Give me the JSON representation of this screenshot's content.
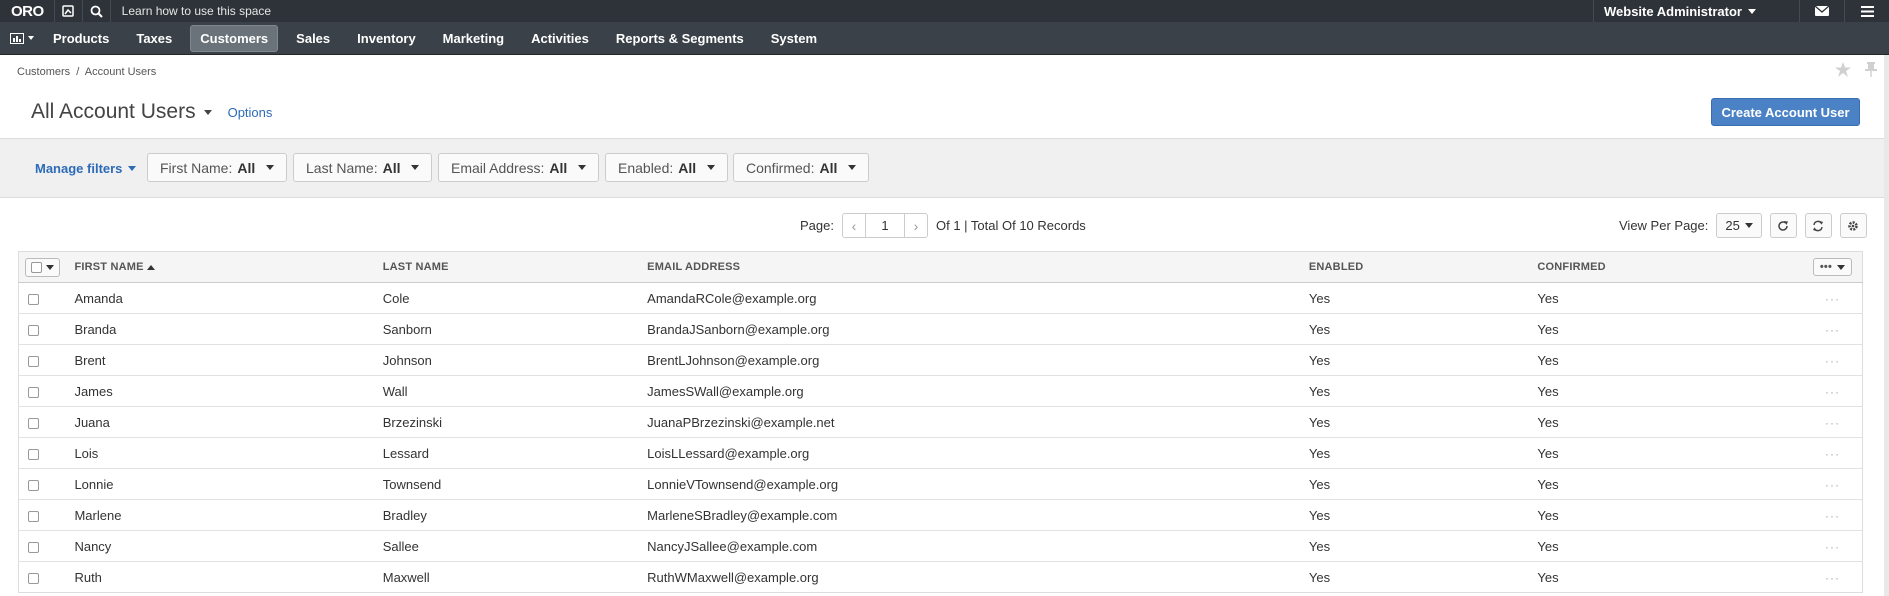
{
  "topbar": {
    "logo": "ORO",
    "learn_text": "Learn how to use this space",
    "user": "Website Administrator"
  },
  "nav": {
    "items": [
      "Products",
      "Taxes",
      "Customers",
      "Sales",
      "Inventory",
      "Marketing",
      "Activities",
      "Reports & Segments",
      "System"
    ],
    "active": "Customers"
  },
  "breadcrumb": {
    "parent": "Customers",
    "sep": "/",
    "current": "Account Users"
  },
  "page": {
    "title": "All Account Users",
    "options_label": "Options",
    "create_label": "Create Account User"
  },
  "filters": {
    "manage_label": "Manage filters",
    "items": [
      {
        "label": "First Name:",
        "value": "All"
      },
      {
        "label": "Last Name:",
        "value": "All"
      },
      {
        "label": "Email Address:",
        "value": "All"
      },
      {
        "label": "Enabled:",
        "value": "All"
      },
      {
        "label": "Confirmed:",
        "value": "All"
      }
    ]
  },
  "pager": {
    "label": "Page:",
    "current": "1",
    "summary": "Of 1 | Total Of 10 Records"
  },
  "view_per_page": {
    "label": "View Per Page:",
    "value": "25"
  },
  "table": {
    "columns": [
      "FIRST NAME",
      "LAST NAME",
      "EMAIL ADDRESS",
      "ENABLED",
      "CONFIRMED"
    ],
    "rows": [
      [
        "Amanda",
        "Cole",
        "AmandaRCole@example.org",
        "Yes",
        "Yes"
      ],
      [
        "Branda",
        "Sanborn",
        "BrandaJSanborn@example.org",
        "Yes",
        "Yes"
      ],
      [
        "Brent",
        "Johnson",
        "BrentLJohnson@example.org",
        "Yes",
        "Yes"
      ],
      [
        "James",
        "Wall",
        "JamesSWall@example.org",
        "Yes",
        "Yes"
      ],
      [
        "Juana",
        "Brzezinski",
        "JuanaPBrzezinski@example.net",
        "Yes",
        "Yes"
      ],
      [
        "Lois",
        "Lessard",
        "LoisLLessard@example.org",
        "Yes",
        "Yes"
      ],
      [
        "Lonnie",
        "Townsend",
        "LonnieVTownsend@example.org",
        "Yes",
        "Yes"
      ],
      [
        "Marlene",
        "Bradley",
        "MarleneSBradley@example.com",
        "Yes",
        "Yes"
      ],
      [
        "Nancy",
        "Sallee",
        "NancyJSallee@example.com",
        "Yes",
        "Yes"
      ],
      [
        "Ruth",
        "Maxwell",
        "RuthWMaxwell@example.org",
        "Yes",
        "Yes"
      ]
    ]
  },
  "colors": {
    "topbar": "#2d3338",
    "navbar": "#3a4148",
    "accent": "#4a82c5",
    "link": "#2d6bb7"
  }
}
